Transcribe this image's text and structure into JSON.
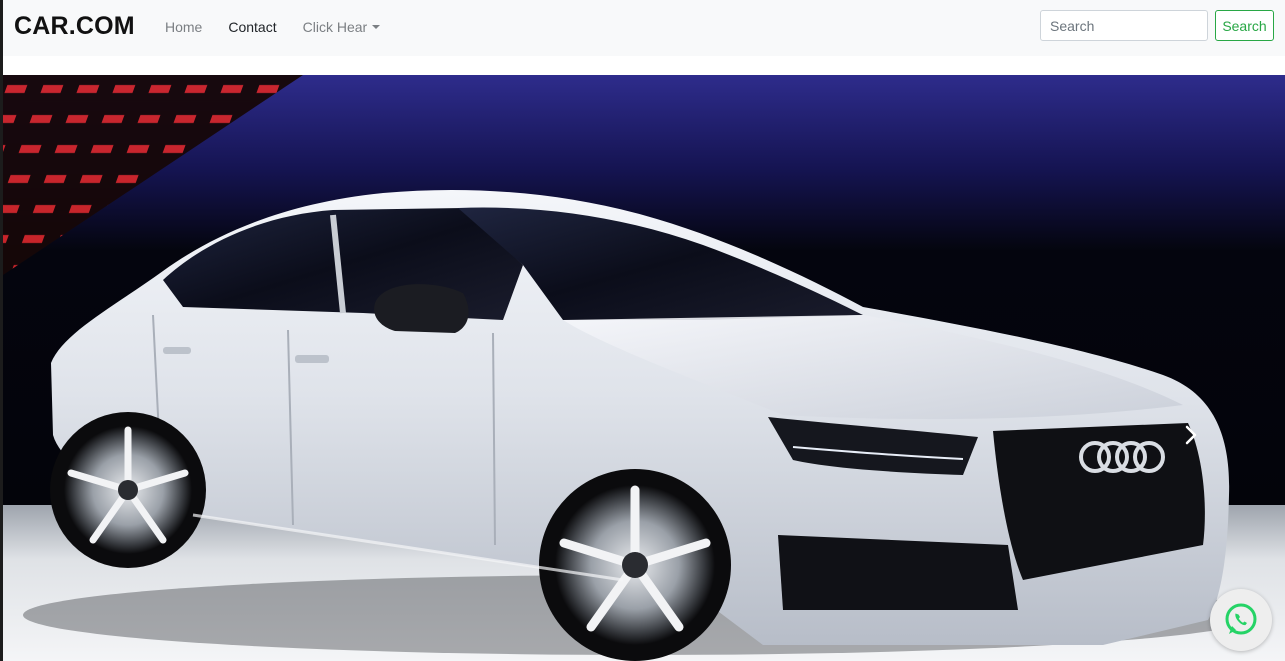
{
  "navbar": {
    "brand": "CAR.COM",
    "links": [
      {
        "label": "Home",
        "active": false
      },
      {
        "label": "Contact",
        "active": true
      },
      {
        "label": "Click Hear",
        "dropdown": true
      }
    ],
    "search": {
      "placeholder": "Search",
      "value": "",
      "button_label": "Search"
    }
  },
  "hero": {
    "image": "white-sports-sedan-showroom",
    "next_icon": "chevron-right-icon"
  },
  "floating": {
    "icon": "whatsapp-icon",
    "color": "#25d366"
  },
  "colors": {
    "accent": "#28a745",
    "navbar_bg": "#f8f9fa"
  }
}
